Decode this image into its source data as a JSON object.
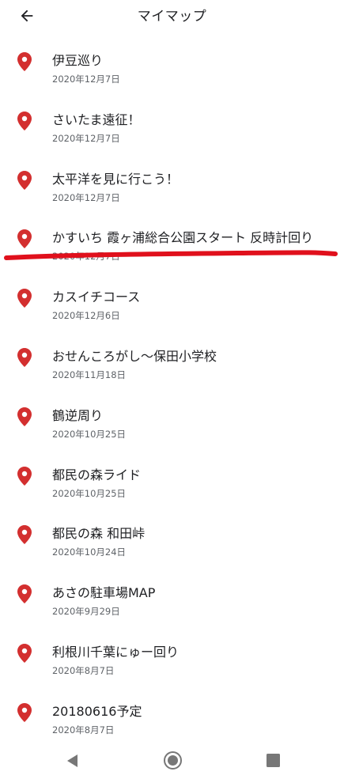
{
  "header": {
    "title": "マイマップ",
    "back_icon": "arrow-back-icon"
  },
  "colors": {
    "pin": "#d32f2f",
    "annotation_stroke": "#e0101c",
    "nav_icon": "#777777"
  },
  "maps": [
    {
      "title": "伊豆巡り",
      "date": "2020年12月7日"
    },
    {
      "title": "さいたま遠征！",
      "date": "2020年12月7日"
    },
    {
      "title": "太平洋を見に行こう！",
      "date": "2020年12月7日"
    },
    {
      "title": "かすいち 霞ヶ浦総合公園スタート 反時計回り",
      "date": "2020年12月7日"
    },
    {
      "title": "カスイチコース",
      "date": "2020年12月6日"
    },
    {
      "title": "おせんころがし〜保田小学校",
      "date": "2020年11月18日"
    },
    {
      "title": "鶴逆周り",
      "date": "2020年10月25日"
    },
    {
      "title": "都民の森ライド",
      "date": "2020年10月25日"
    },
    {
      "title": "都民の森 和田峠",
      "date": "2020年10月24日"
    },
    {
      "title": "あさの駐車場MAP",
      "date": "2020年9月29日"
    },
    {
      "title": "利根川千葉にゅー回り",
      "date": "2020年8月7日"
    },
    {
      "title": "20180616予定",
      "date": "2020年8月7日"
    }
  ],
  "nav_bar": {
    "back_icon": "triangle-back-icon",
    "home_icon": "circle-home-icon",
    "recents_icon": "square-recents-icon"
  }
}
